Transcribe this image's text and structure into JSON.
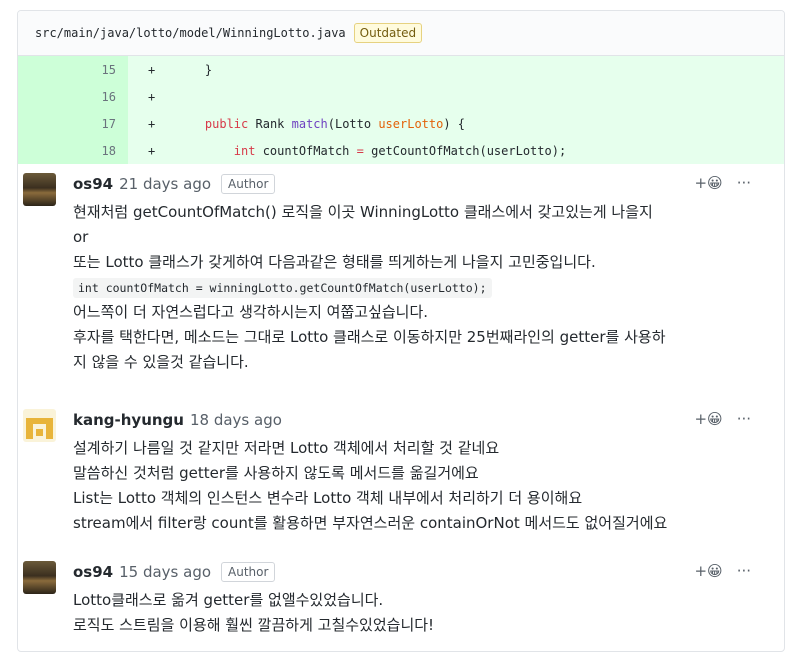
{
  "file": {
    "path": "src/main/java/lotto/model/WinningLotto.java",
    "status_badge": "Outdated"
  },
  "diff_lines": [
    {
      "num": "15",
      "sign": "+",
      "code": "    }"
    },
    {
      "num": "16",
      "sign": "+",
      "code": ""
    },
    {
      "num": "17",
      "sign": "+",
      "code": "public Rank match(Lotto userLotto) {"
    },
    {
      "num": "18",
      "sign": "+",
      "code": "int countOfMatch = getCountOfMatch(userLotto);"
    }
  ],
  "comments": [
    {
      "author": "os94",
      "time": "21 days ago",
      "badge": "Author",
      "body": [
        "현재처럼 getCountOfMatch() 로직을 이곳 WinningLotto 클래스에서 갖고있는게 나을지",
        "or",
        "또는 Lotto 클래스가 갖게하여 다음과같은 형태를 띄게하는게 나을지 고민중입니다.",
        "int countOfMatch = winningLotto.getCountOfMatch(userLotto);",
        "어느쪽이 더 자연스럽다고 생각하시는지 여쭙고싶습니다.",
        "후자를 택한다면, 메소드는 그대로 Lotto 클래스로 이동하지만 25번째라인의 getter를 사용하",
        "지 않을 수 있을것 같습니다."
      ]
    },
    {
      "author": "kang-hyungu",
      "time": "18 days ago",
      "body": [
        "설계하기 나름일 것 같지만 저라면 Lotto 객체에서 처리할 것 같네요",
        "말씀하신 것처럼 getter를 사용하지 않도록 메서드를 옮길거에요",
        "List는 Lotto 객체의 인스턴스 변수라 Lotto 객체 내부에서 처리하기 더 용이해요",
        "stream에서 filter랑 count를 활용하면 부자연스러운 containOrNot 메서드도 없어질거에요"
      ]
    },
    {
      "author": "os94",
      "time": "15 days ago",
      "badge": "Author",
      "body": [
        "Lotto클래스로 옮겨 getter를 없앨수있었습니다.",
        "로직도 스트림을 이용해 훨씬 깔끔하게 고칠수있었습니다!"
      ]
    }
  ],
  "actions": {
    "reaction": "+😀",
    "more": "···"
  }
}
